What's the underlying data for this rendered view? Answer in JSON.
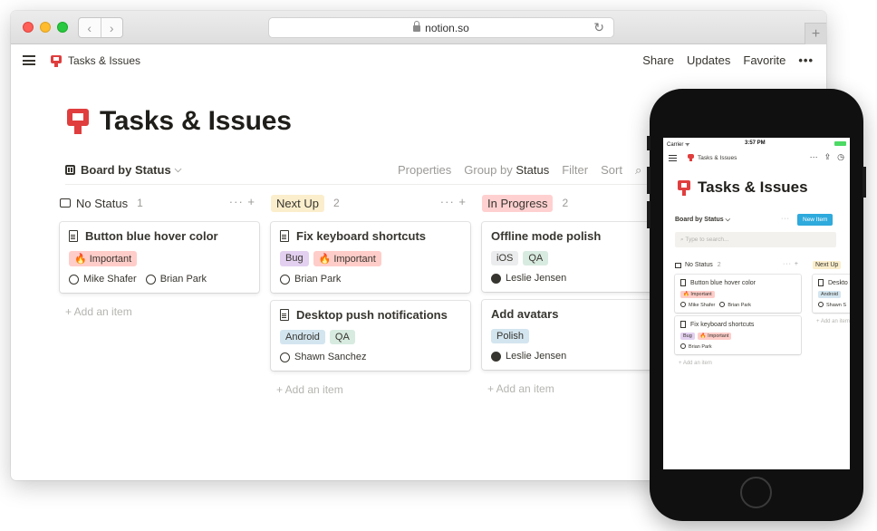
{
  "browser": {
    "url": "notion.so",
    "back_glyph": "‹",
    "forward_glyph": "›",
    "reload_glyph": "↻",
    "newtab_glyph": "+"
  },
  "topbar": {
    "breadcrumb": "Tasks & Issues",
    "share": "Share",
    "updates": "Updates",
    "favorite": "Favorite",
    "more": "•••"
  },
  "page": {
    "title": "Tasks & Issues",
    "view_name": "Board by Status",
    "view_caret": "⌵",
    "options": {
      "properties": "Properties",
      "group_by": "Group by",
      "group_by_value": "Status",
      "filter": "Filter",
      "sort": "Sort",
      "search_glyph": "⌕"
    }
  },
  "colors": {
    "important": "#ffcdc9",
    "bug": "#e3d0f0",
    "android": "#d3e5ef",
    "qa": "#d8ebe1",
    "ios": "#ebeced",
    "polish": "#d3e5ef",
    "next_up": "#fbeecc",
    "in_progress": "#ffd0d0",
    "new_item": "#2eaadc"
  },
  "board": {
    "add_item": "+ Add an item",
    "columns": [
      {
        "name": "No Status",
        "count": "1",
        "actions": "···  +",
        "cards": [
          {
            "title": "Button blue hover color",
            "tags": [
              "🔥 Important"
            ],
            "people": [
              "Mike Shafer",
              "Brian Park"
            ]
          }
        ]
      },
      {
        "name": "Next Up",
        "count": "2",
        "actions": "···  +",
        "cards": [
          {
            "title": "Fix keyboard shortcuts",
            "tags": [
              "Bug",
              "🔥 Important"
            ],
            "people": [
              "Brian Park"
            ]
          },
          {
            "title": "Desktop push notifications",
            "tags": [
              "Android",
              "QA"
            ],
            "people": [
              "Shawn Sanchez"
            ]
          }
        ]
      },
      {
        "name": "In Progress",
        "count": "2",
        "cards": [
          {
            "title": "Offline mode polish",
            "tags": [
              "iOS",
              "QA"
            ],
            "people": [
              "Leslie Jensen"
            ]
          },
          {
            "title": "Add avatars",
            "tags": [
              "Polish"
            ],
            "people": [
              "Leslie Jensen"
            ]
          }
        ]
      }
    ]
  },
  "phone": {
    "carrier": "Carrier ᯤ",
    "time": "3:57 PM",
    "breadcrumb": "Tasks & Issues",
    "top_icons": [
      "···",
      "⇪",
      "◷"
    ],
    "title": "Tasks & Issues",
    "view_name": "Board by Status ⌵",
    "dots": "···",
    "new_item": "New Item",
    "search_placeholder": "⌕ Type to search...",
    "col1": {
      "name": "No Status",
      "count": "2",
      "actions": "··· +",
      "cards": [
        {
          "title": "Button blue hover color",
          "tags": [
            "🔥 Important"
          ],
          "people": [
            "Mike Shafer",
            "Brian Park"
          ]
        },
        {
          "title": "Fix keyboard shortcuts",
          "tags": [
            "Bug",
            "🔥 Important"
          ],
          "people": [
            "Brian Park"
          ]
        }
      ]
    },
    "col2": {
      "name": "Next Up",
      "cards": [
        {
          "title": "Deskto",
          "tags": [
            "Android"
          ],
          "people": [
            "Shawn S"
          ]
        }
      ]
    },
    "add_item": "+ Add an item"
  }
}
